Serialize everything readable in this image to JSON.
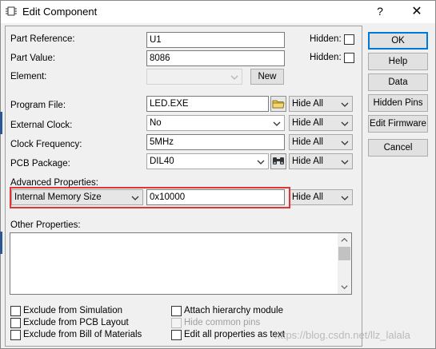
{
  "window": {
    "title": "Edit Component",
    "help_glyph": "?",
    "close_glyph": "✕"
  },
  "fields": {
    "part_reference": {
      "label": "Part Reference:",
      "value": "U1"
    },
    "part_value": {
      "label": "Part Value:",
      "value": "8086"
    },
    "element": {
      "label": "Element:",
      "value": "",
      "new_button": "New"
    },
    "hidden_label": "Hidden:",
    "program_file": {
      "label": "Program File:",
      "value": "LED.EXE",
      "visibility": "Hide All"
    },
    "external_clock": {
      "label": "External Clock:",
      "value": "No",
      "visibility": "Hide All"
    },
    "clock_frequency": {
      "label": "Clock Frequency:",
      "value": "5MHz",
      "visibility": "Hide All"
    },
    "pcb_package": {
      "label": "PCB Package:",
      "value": "DIL40",
      "visibility": "Hide All"
    }
  },
  "advanced": {
    "label": "Advanced Properties:",
    "property": "Internal Memory Size",
    "value": "0x10000",
    "visibility": "Hide All"
  },
  "other_properties": {
    "label": "Other Properties:",
    "value": ""
  },
  "checkboxes": {
    "exclude_simulation": "Exclude from Simulation",
    "exclude_pcb": "Exclude from PCB Layout",
    "exclude_bom": "Exclude from Bill of Materials",
    "attach_hierarchy": "Attach hierarchy module",
    "hide_common_pins": "Hide common pins",
    "edit_all_as_text": "Edit all properties as text"
  },
  "buttons": {
    "ok": "OK",
    "help": "Help",
    "data": "Data",
    "hidden_pins": "Hidden Pins",
    "edit_firmware": "Edit Firmware",
    "cancel": "Cancel"
  },
  "watermark": "https://blog.csdn.net/llz_lalala",
  "colors": {
    "highlight": "#e03535",
    "ok_border": "#0078d7"
  }
}
